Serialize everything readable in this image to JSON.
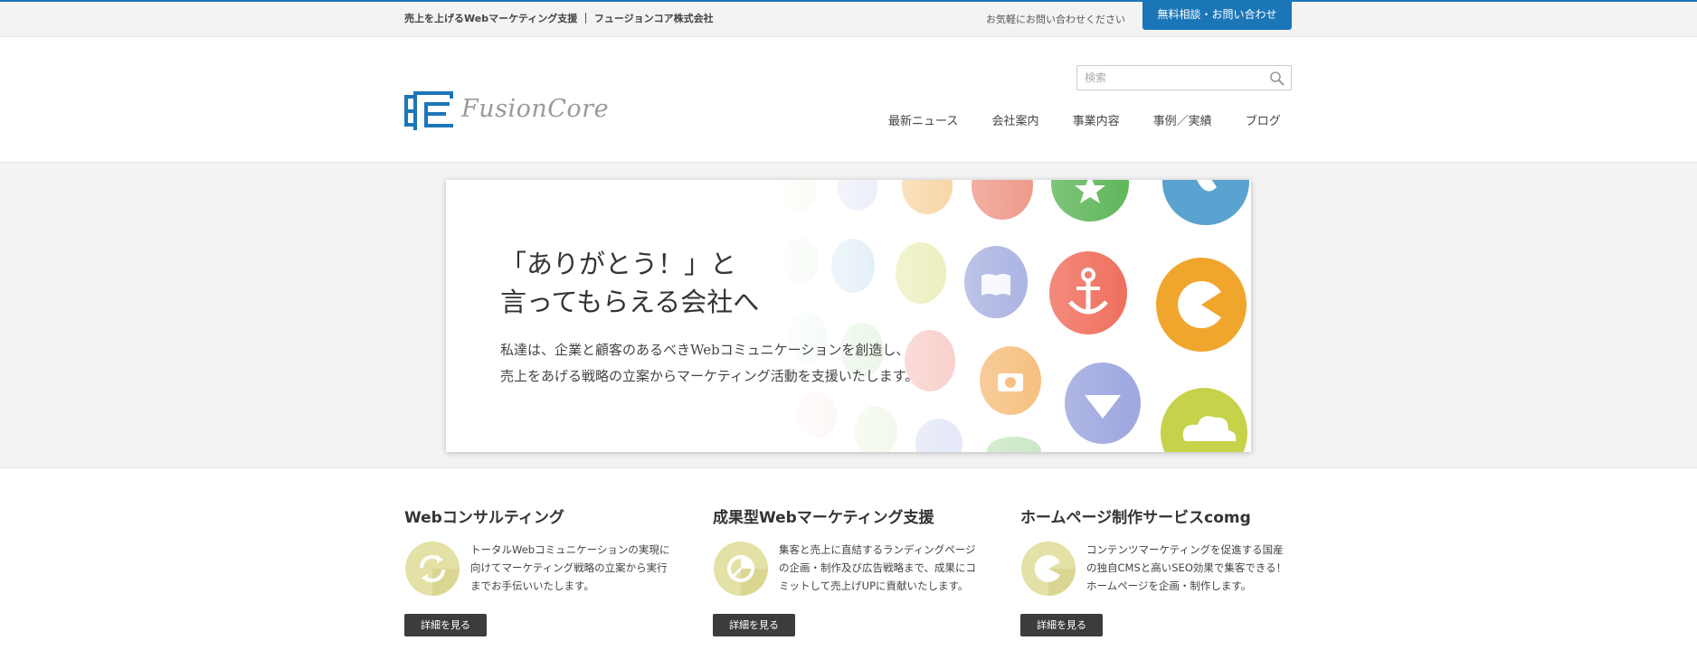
{
  "topbar": {
    "tagline": "売上を上げるWebマーケティング支援 ｜ フュージョンコア株式会社",
    "contact_note": "お気軽にお問い合わせください",
    "contact_button": "無料相談・お問い合わせ"
  },
  "header": {
    "logo_text": "FusionCore",
    "search_placeholder": "検索",
    "nav": [
      "最新ニュース",
      "会社案内",
      "事業内容",
      "事例／実績",
      "ブログ"
    ]
  },
  "hero": {
    "title": "「ありがとう！」と\n言ってもらえる会社へ",
    "subtitle": "私達は、企業と顧客のあるべきWebコミュニケーションを創造し、\n売上をあげる戦略の立案からマーケティング活動を支援いたします。"
  },
  "services": [
    {
      "title": "Webコンサルティング",
      "icon": "refresh-icon",
      "description": "トータルWebコミュニケーションの実現に\n向けてマーケティング戦略の立案から実行\nまでお手伝いいたします。",
      "button": "詳細を見る"
    },
    {
      "title": "成果型Webマーケティング支援",
      "icon": "pie-chart-icon",
      "description": "集客と売上に直結するランディングページ\nの企画・制作及び広告戦略まで、成果にコ\nミットして売上げUPに貢献いたします。",
      "button": "詳細を見る"
    },
    {
      "title": "ホームページ制作サービスcomg",
      "icon": "pacman-chart-icon",
      "description": "コンテンツマーケティングを促進する国産\nの独自CMSと高いSEO効果で集客できる！\nホームページを企画・制作します。",
      "button": "詳細を見る"
    }
  ],
  "colors": {
    "brand_blue": "#1b76b8",
    "button_dark": "#3c3c3c",
    "icon_bg": "#e4e1a6"
  }
}
